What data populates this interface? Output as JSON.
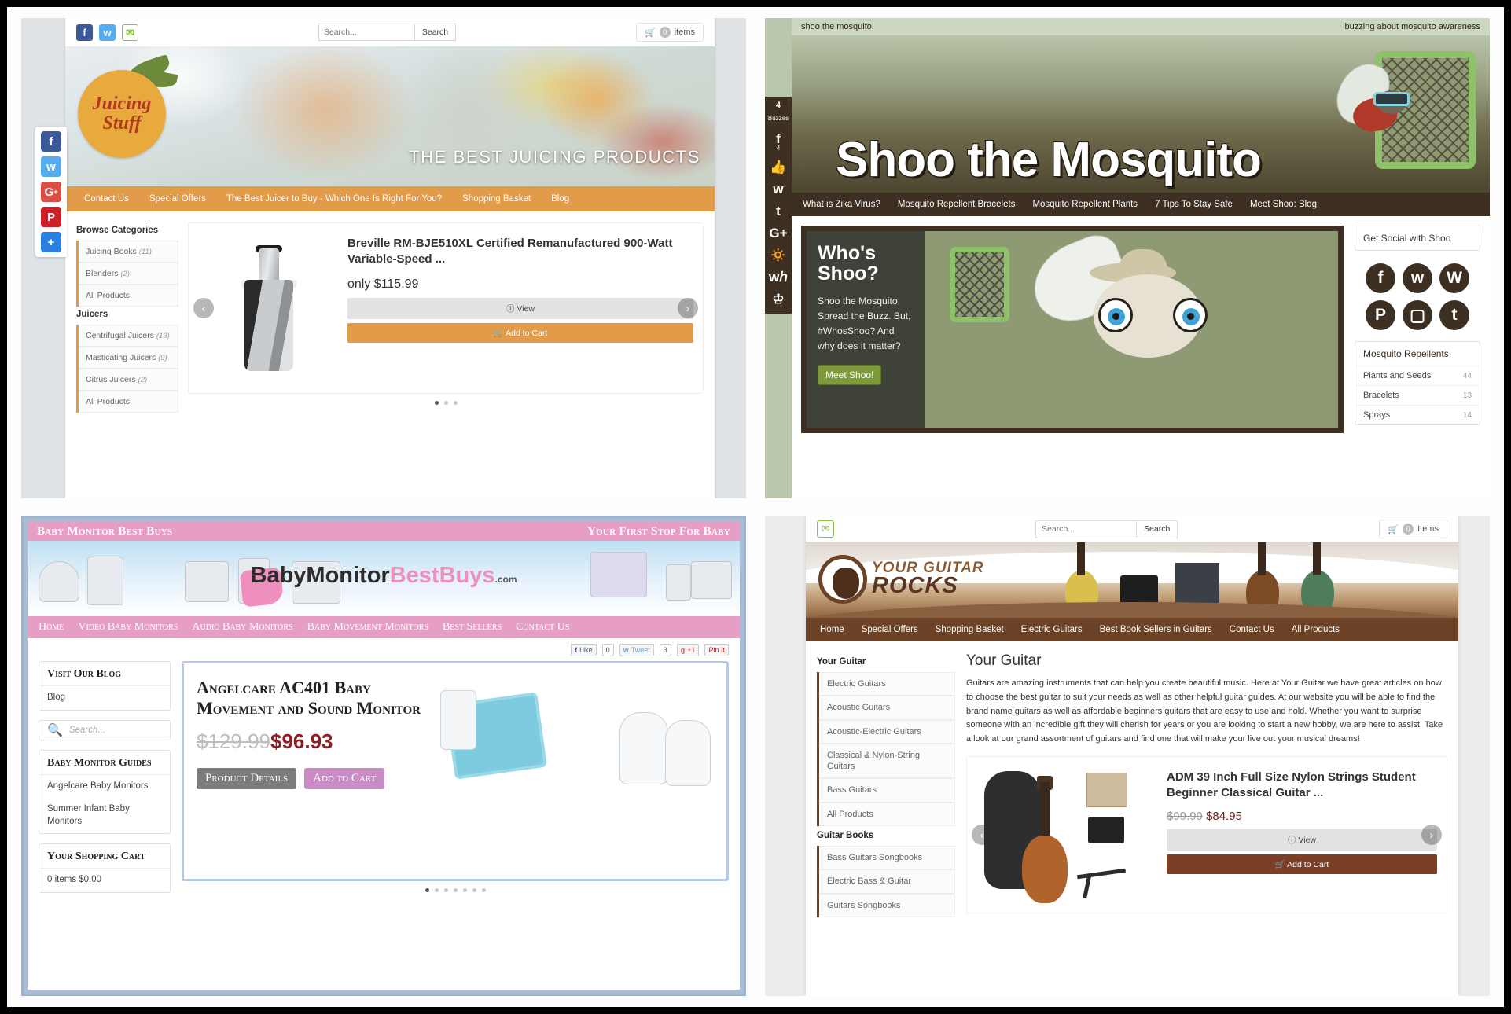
{
  "panels": {
    "juicing": {
      "site_name": "Juicing Stuff",
      "hero_caption": "THE BEST JUICING PRODUCTS",
      "search": {
        "placeholder": "Search...",
        "button": "Search"
      },
      "cart": {
        "count": "0",
        "label": "items"
      },
      "top_social": [
        "facebook-icon",
        "twitter-icon",
        "email-icon"
      ],
      "float_social": [
        "facebook-icon",
        "twitter-icon",
        "googleplus-icon",
        "pinterest-icon",
        "share-plus-icon"
      ],
      "nav": [
        "Contact Us",
        "Special Offers",
        "The Best Juicer to Buy - Which One Is Right For You?",
        "Shopping Basket",
        "Blog"
      ],
      "sidebar": [
        {
          "heading": "Browse Categories",
          "items": [
            {
              "label": "Juicing Books",
              "count": "(11)"
            },
            {
              "label": "Blenders",
              "count": "(2)"
            },
            {
              "label": "All Products",
              "count": ""
            }
          ]
        },
        {
          "heading": "Juicers",
          "items": [
            {
              "label": "Centrifugal Juicers",
              "count": "(13)"
            },
            {
              "label": "Masticating Juicers",
              "count": "(9)"
            },
            {
              "label": "Citrus Juicers",
              "count": "(2)"
            },
            {
              "label": "All Products",
              "count": ""
            }
          ]
        }
      ],
      "product": {
        "title": "Breville RM-BJE510XL Certified Remanufactured 900-Watt Variable-Speed ...",
        "price": "only $115.99",
        "view_label": "View",
        "cart_label": "Add to Cart"
      },
      "carousel": {
        "prev": "‹",
        "next": "›",
        "dots": 3,
        "active_dot": 0
      },
      "accent": "#e29c49"
    },
    "mosquito": {
      "top_left": "shoo the mosquito!",
      "top_right": "buzzing about mosquito awareness",
      "title": "Shoo the Mosquito",
      "nav": [
        "What is Zika Virus?",
        "Mosquito Repellent Bracelets",
        "Mosquito Repellent Plants",
        "7 Tips To Stay Safe",
        "Meet Shoo: Blog"
      ],
      "rail": {
        "count": "4",
        "count_label": "Buzzes",
        "fb_count": "4",
        "icons": [
          "facebook-icon",
          "thumbs-up-icon",
          "twitter-icon",
          "tumblr-icon",
          "googleplus-icon",
          "stumbleupon-icon",
          "pinterest-icon",
          "crown-icon"
        ]
      },
      "feature": {
        "heading_line1": "Who's",
        "heading_line2": "Shoo?",
        "body": "Shoo the Mosquito; Spread the Buzz. But, #WhosShoo? And why does it matter?",
        "button": "Meet Shoo!"
      },
      "social_card": {
        "heading": "Get Social with Shoo",
        "icons": [
          "facebook-icon",
          "twitter-icon",
          "wordpress-icon",
          "pinterest-icon",
          "instagram-icon",
          "tumblr-icon"
        ]
      },
      "repellents": {
        "heading": "Mosquito Repellents",
        "rows": [
          {
            "label": "Plants and Seeds",
            "count": "44"
          },
          {
            "label": "Bracelets",
            "count": "13"
          },
          {
            "label": "Sprays",
            "count": "14"
          }
        ]
      },
      "accent": "#3d2f21"
    },
    "baby": {
      "top_left": "Baby Monitor Best Buys",
      "top_right": "Your First Stop For Baby",
      "logo": {
        "part1": "BabyMonitor",
        "part2": "BestBuys",
        "tld": ".com"
      },
      "nav": [
        "Home",
        "Video Baby Monitors",
        "Audio Baby Monitors",
        "Baby Movement Monitors",
        "Best Sellers",
        "Contact Us"
      ],
      "share": [
        {
          "name": "facebook-like-button",
          "label": "Like",
          "count": "0"
        },
        {
          "name": "twitter-tweet-button",
          "label": "Tweet",
          "count": "3"
        },
        {
          "name": "googleplus-button",
          "label": "+1",
          "count": ""
        },
        {
          "name": "pinterest-button",
          "label": "Pin It",
          "count": ""
        }
      ],
      "sidebar": {
        "blog_card": {
          "heading": "Visit Our Blog",
          "item": "Blog"
        },
        "search_placeholder": "Search...",
        "guides_card": {
          "heading": "Baby Monitor Guides",
          "items": [
            "Angelcare Baby Monitors",
            "Summer Infant Baby Monitors"
          ]
        },
        "cart_card": {
          "heading": "Your Shopping Cart",
          "value": "0 items   $0.00"
        }
      },
      "product": {
        "title": "Angelcare AC401 Baby Movement and Sound Monitor",
        "old_price": "$129.99",
        "new_price": "$96.93",
        "btn_details": "Product Details",
        "btn_cart": "Add to Cart"
      },
      "carousel": {
        "dots": 7,
        "active_dot": 0
      },
      "accent": "#e79ec4"
    },
    "guitar": {
      "search": {
        "placeholder": "Search...",
        "button": "Search"
      },
      "cart": {
        "count": "0",
        "label": "Items"
      },
      "logo": {
        "line1": "YOUR GUITAR",
        "line2": "ROCKS"
      },
      "nav": [
        "Home",
        "Special Offers",
        "Shopping Basket",
        "Electric Guitars",
        "Best Book Sellers in Guitars",
        "Contact Us",
        "All Products"
      ],
      "sidebar": [
        {
          "heading": "Your Guitar",
          "items": [
            "Electric Guitars",
            "Acoustic Guitars",
            "Acoustic-Electric Guitars",
            "Classical & Nylon-String Guitars",
            "Bass Guitars",
            "All Products"
          ]
        },
        {
          "heading": "Guitar Books",
          "items": [
            "Bass Guitars Songbooks",
            "Electric Bass & Guitar",
            "Guitars Songbooks"
          ]
        }
      ],
      "page_title": "Your Guitar",
      "intro": "Guitars are amazing instruments that can help you create beautiful music. Here at Your Guitar we have great articles on how to choose the best guitar to suit your needs as well as other helpful guitar guides. At our website you will be able to find the brand name guitars as well as affordable beginners guitars that are easy to use and hold. Whether you want to surprise someone with an incredible gift they will cherish for years or you are looking to start a new hobby, we are here to assist. Take a look at our grand assortment of guitars and find one that will make your live out your musical dreams!",
      "product": {
        "title": "ADM 39 Inch Full Size Nylon Strings Student Beginner Classical Guitar ...",
        "old_price": "$99.99",
        "new_price": "$84.95",
        "view_label": "View",
        "cart_label": "Add to Cart"
      },
      "carousel": {
        "prev": "‹",
        "next": "›"
      },
      "accent": "#6b4226"
    }
  }
}
